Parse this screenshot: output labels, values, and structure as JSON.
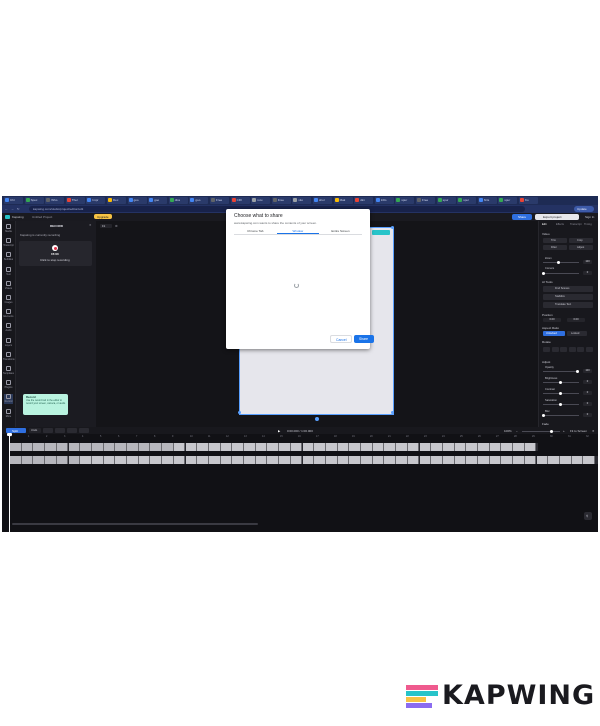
{
  "browser": {
    "tabs": [
      {
        "label": "Chr",
        "color": "#4285f4"
      },
      {
        "label": "Spec",
        "color": "#34a853"
      },
      {
        "label": "Who",
        "color": "#5f6368"
      },
      {
        "label": "Ther",
        "color": "#ea4335"
      },
      {
        "label": "Impr",
        "color": "#4285f4"
      },
      {
        "label": "Dec",
        "color": "#fbbc05"
      },
      {
        "label": "goo",
        "color": "#4285f4"
      },
      {
        "label": "goo",
        "color": "#4285f4"
      },
      {
        "label": "diss",
        "color": "#34a853"
      },
      {
        "label": "goo",
        "color": "#4285f4"
      },
      {
        "label": "Free",
        "color": "#5f6368"
      },
      {
        "label": "CRI",
        "color": "#ea4335"
      },
      {
        "label": "rutu",
        "color": "#9aa0a6"
      },
      {
        "label": "Free",
        "color": "#5f6368"
      },
      {
        "label": "vito",
        "color": "#9aa0a6"
      },
      {
        "label": "shor",
        "color": "#4285f4"
      },
      {
        "label": "Mak",
        "color": "#fbbc05"
      },
      {
        "label": "dim",
        "color": "#ea4335"
      },
      {
        "label": "Inflo",
        "color": "#4285f4"
      },
      {
        "label": "spur",
        "color": "#34a853"
      },
      {
        "label": "Free",
        "color": "#5f6368"
      },
      {
        "label": "spur",
        "color": "#34a853"
      },
      {
        "label": "spur",
        "color": "#34a853"
      },
      {
        "label": "Nrts",
        "color": "#4285f4"
      },
      {
        "label": "spur",
        "color": "#34a853"
      },
      {
        "label": "Ko",
        "color": "#ea4335"
      }
    ],
    "url": "kapwing.com/studio/project/editor/edit",
    "update_label": "Update"
  },
  "app": {
    "workspace": "Kapwing",
    "project": "Untitled Project",
    "upgrade": "Upgrade",
    "share": "Share",
    "export_label": "Export project",
    "signin": "Sign In"
  },
  "rail": [
    {
      "label": "Media",
      "icon": "media-icon"
    },
    {
      "label": "Transcript",
      "icon": "transcript-icon"
    },
    {
      "label": "Subtitles",
      "icon": "subtitles-icon"
    },
    {
      "label": "Text",
      "icon": "text-icon"
    },
    {
      "label": "Videos",
      "icon": "videos-icon"
    },
    {
      "label": "Images",
      "icon": "images-icon"
    },
    {
      "label": "Elements",
      "icon": "elements-icon"
    },
    {
      "label": "Audio",
      "icon": "audio-icon"
    },
    {
      "label": "Layers",
      "icon": "layers-icon"
    },
    {
      "label": "Transitions",
      "icon": "transitions-icon"
    },
    {
      "label": "Templates",
      "icon": "templates-icon"
    },
    {
      "label": "Plugins",
      "icon": "plugins-icon"
    },
    {
      "label": "Record",
      "icon": "record-icon"
    },
    {
      "label": "More",
      "icon": "more-icon"
    }
  ],
  "record_panel": {
    "title": "RECORD",
    "status": "Kapwing is currently recording",
    "time": "15:00",
    "stop": "Click to stop recording",
    "tip_title": "Record",
    "tip_body": "Use the record tool in the editor to record your screen, camera, or audio"
  },
  "stage": {
    "aspect": "9:16",
    "fit_label": "Fit"
  },
  "dialog": {
    "title": "Choose what to share",
    "subtitle": "www.kapwing.com wants to share the contents of your screen.",
    "tabs": [
      "Chrome Tab",
      "Window",
      "Entire Screen"
    ],
    "active_tab": 1,
    "cancel": "Cancel",
    "share": "Share"
  },
  "right_panel": {
    "tabs": [
      "Edit",
      "Effects",
      "Transcript",
      "Timing"
    ],
    "video_header": "Video",
    "video_buttons": [
      "Trim",
      "Crop",
      "Filter",
      "Adjust"
    ],
    "zoom_label": "Zoom",
    "zoom_value": "100",
    "corners_label": "Corners",
    "corners_value": "0",
    "ai_header": "AI Tools",
    "ai_buttons": [
      "Find Scenes",
      "Stabilize",
      "Translate Text"
    ],
    "position_header": "Position",
    "pos_x": "0.00",
    "pos_y": "0.00",
    "aspect_header": "Aspect Ratio",
    "aspect_options": [
      "Unlocked",
      "Locked"
    ],
    "rotate_header": "Rotate",
    "adjust_header": "Adjust",
    "sliders": [
      {
        "label": "Opacity",
        "value": "100",
        "level": 1.0
      },
      {
        "label": "Brightness",
        "value": "0",
        "level": 0.5
      },
      {
        "label": "Contrast",
        "value": "0",
        "level": 0.5
      },
      {
        "label": "Saturation",
        "value": "0",
        "level": 0.5
      },
      {
        "label": "Blur",
        "value": "0",
        "level": 0.0
      }
    ],
    "fade_header": "Fade"
  },
  "timeline": {
    "split_label": "Split",
    "undo_label": "Undo",
    "timecode": "0:00.000 / 1:00.000",
    "speed": "100%",
    "fit_screen": "Fit to Screen",
    "ruler": [
      "0",
      "1",
      "2",
      "3",
      "4",
      "5",
      "6",
      "7",
      "8",
      "9",
      "10",
      "11",
      "12",
      "13",
      "14",
      "15",
      "16",
      "17",
      "18",
      "19",
      "20",
      "21",
      "22",
      "23",
      "24",
      "25",
      "26",
      "27",
      "28",
      "29",
      "30",
      "31",
      "32",
      "33"
    ]
  },
  "watermark": {
    "brand": "KAPWING",
    "colors": [
      "#ef5a8e",
      "#27c4c9",
      "#f7c344",
      "#8b6cf0"
    ]
  }
}
